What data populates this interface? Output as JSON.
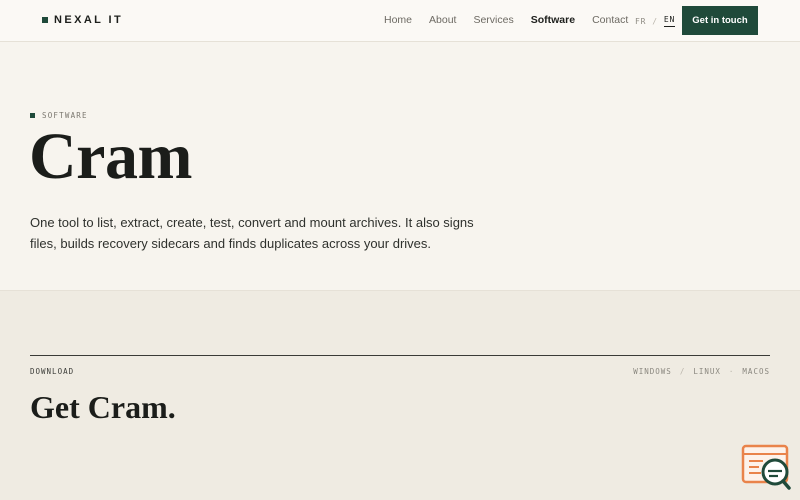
{
  "brand": {
    "name": "NEXAL IT",
    "accent": "#1f4a3a"
  },
  "nav": {
    "items": [
      {
        "label": "Home",
        "active": false
      },
      {
        "label": "About",
        "active": false
      },
      {
        "label": "Services",
        "active": false
      },
      {
        "label": "Software",
        "active": true
      },
      {
        "label": "Contact",
        "active": false
      }
    ]
  },
  "lang": {
    "options": [
      "FR",
      "EN"
    ],
    "separator": "/",
    "selected": "EN"
  },
  "cta": {
    "label": "Get in touch"
  },
  "hero": {
    "eyebrow": "SOFTWARE",
    "title": "Cram",
    "description": "One tool to list, extract, create, test, convert and mount archives. It also signs files, builds recovery sidecars and finds duplicates across your drives."
  },
  "download": {
    "label": "DOWNLOAD",
    "platforms": [
      "WINDOWS",
      "LINUX",
      "MACOS"
    ],
    "platform_separators": [
      "/",
      "·"
    ],
    "title": "Get Cram."
  },
  "widget": {
    "icon": "chat-support-icon",
    "color": "#e9834a"
  }
}
